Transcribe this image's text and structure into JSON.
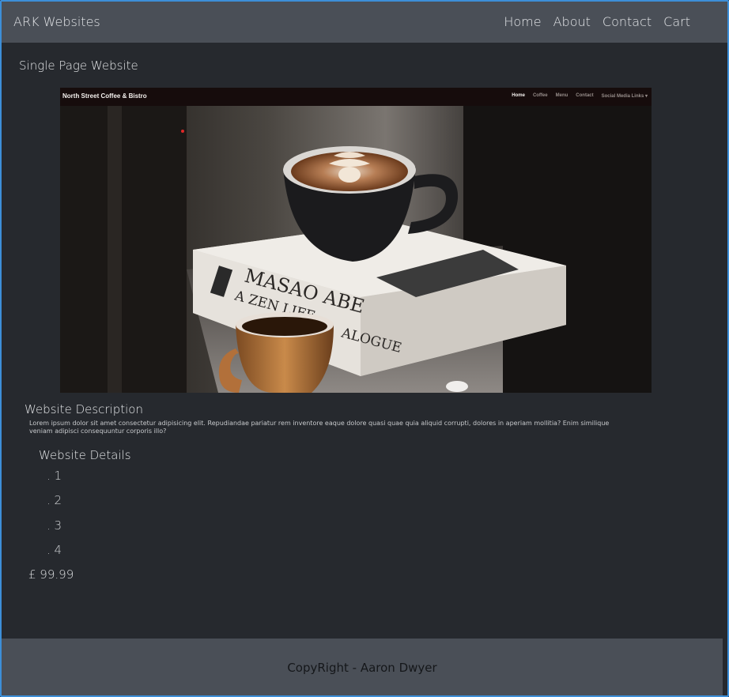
{
  "header": {
    "brand": "ARK Websites",
    "nav": [
      "Home",
      "About",
      "Contact",
      "Cart"
    ]
  },
  "page": {
    "title": "Single Page Website"
  },
  "preview": {
    "brand": "North Street Coffee & Bistro",
    "links": [
      "Home",
      "Coffee",
      "Menu",
      "Contact",
      "Social Media Links ▾"
    ],
    "book_title_line1": "MASAO ABE",
    "book_title_line2": "A ZEN LIFE",
    "book_title_line3": "ALOGUE"
  },
  "description": {
    "heading": "Website Description",
    "text": "Lorem ipsum dolor sit amet consectetur adipisicing elit. Repudiandae pariatur rem inventore eaque dolore quasi quae quia aliquid corrupti, dolores in aperiam mollitia? Enim similique veniam adipisci consequuntur corporis illo?"
  },
  "details": {
    "heading": "Website Details",
    "items": [
      ". 1",
      ". 2",
      ". 3",
      ". 4"
    ]
  },
  "price": "£ 99.99",
  "footer": {
    "text": "CopyRight - Aaron Dwyer"
  },
  "colors": {
    "navbar": "#4a4f57",
    "background": "#26292e",
    "border": "#3d8fd8"
  }
}
